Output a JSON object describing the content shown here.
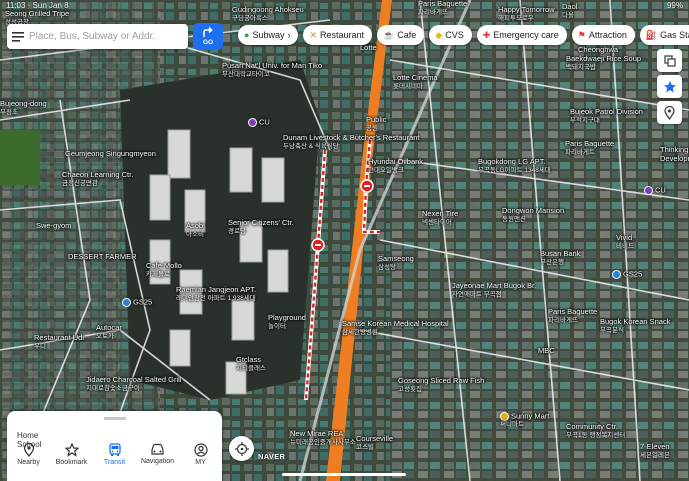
{
  "status_bar": {
    "time": "11:03",
    "date": "Sun Jan 8",
    "battery": "99%"
  },
  "search": {
    "placeholder": "Place, Bus, Subway or Addr.",
    "go_label": "GO"
  },
  "chips": [
    {
      "label": "Subway",
      "icon": "subway-icon"
    },
    {
      "label": "Restaurant",
      "icon": "utensils-icon"
    },
    {
      "label": "Cafe",
      "icon": "coffee-icon"
    },
    {
      "label": "CVS",
      "icon": "store-icon"
    },
    {
      "label": "Emergency care",
      "icon": "hospital-icon"
    },
    {
      "label": "Attraction",
      "icon": "flag-icon"
    },
    {
      "label": "Gas Stat",
      "icon": "fuel-icon"
    }
  ],
  "side_buttons": [
    "layers-icon",
    "favorite-star-icon",
    "location-pin-icon"
  ],
  "bottom_panel": {
    "tabs": [
      "Home",
      "School"
    ],
    "nav": [
      {
        "label": "Nearby",
        "icon": "pin-icon",
        "active": false
      },
      {
        "label": "Bookmark",
        "icon": "star-icon",
        "active": false
      },
      {
        "label": "Transit",
        "icon": "bus-icon",
        "active": true
      },
      {
        "label": "Navigation",
        "icon": "car-icon",
        "active": false
      },
      {
        "label": "MY",
        "icon": "user-icon",
        "active": false
      }
    ]
  },
  "map_labels": [
    {
      "id": "grilled-tripe",
      "en": "Seong Grilled Tripe",
      "ko": "성성곱창"
    },
    {
      "id": "gudingoong",
      "en": "Gudingoong Ahokseu",
      "ko": "구딩궁아흑스"
    },
    {
      "id": "paris-baguette-top",
      "en": "Paris Baguette",
      "ko": "파리바게뜨"
    },
    {
      "id": "happy-tomorrow",
      "en": "Happy Tomorrow",
      "ko": "해피투모로우"
    },
    {
      "id": "daol",
      "en": "Daol",
      "ko": "다올"
    },
    {
      "id": "lotte-top",
      "en": "Lotte",
      "ko": "롯데"
    },
    {
      "id": "pusan-univ",
      "en": "Pusan Nat'l Univ. for Man Tiko",
      "ko": "부산대학교타이코"
    },
    {
      "id": "cheonghwa",
      "en": "Cheonghwa",
      "ko": ""
    },
    {
      "id": "baekdwaeji",
      "en": "Baekdwaeji Rice Soup",
      "ko": "백돼지국밥"
    },
    {
      "id": "lotte-cinema",
      "en": "Lotte Cinema",
      "ko": "롯데시네마"
    },
    {
      "id": "bujeong",
      "en": "Bujeong-dong",
      "ko": "부정초"
    },
    {
      "id": "cu-left",
      "en": "CU",
      "ko": ""
    },
    {
      "id": "public",
      "en": "Public",
      "ko": "공원"
    },
    {
      "id": "bujeok-patrol",
      "en": "Bujeok Patrol Division",
      "ko": "부적지구대"
    },
    {
      "id": "dunam",
      "en": "Dunam Livestock & Butcher's Restaurant",
      "ko": "두남축산 & 식육식당"
    },
    {
      "id": "paris-baguette-right",
      "en": "Paris Baguette",
      "ko": "파리바게트"
    },
    {
      "id": "thinking",
      "en": "Thinking C",
      "ko": ""
    },
    {
      "id": "developm",
      "en": "Developm",
      "ko": ""
    },
    {
      "id": "geumjeong",
      "en": "Geumjeong Singungmyeon",
      "ko": ""
    },
    {
      "id": "chaeon",
      "en": "Chaeon Learning Ctr.",
      "ko": "금정신궁면관"
    },
    {
      "id": "hyundai-oilbank",
      "en": "Hyundai Oilbank",
      "ko": "현대오일뱅크"
    },
    {
      "id": "bugokdong-lg",
      "en": "Bugokdong LG APT.",
      "ko": "부곡동LG아파트 1348세대"
    },
    {
      "id": "cu-right",
      "en": "CU",
      "ko": ""
    },
    {
      "id": "swe-gyom",
      "en": "Swe-gyom",
      "ko": ""
    },
    {
      "id": "asobi",
      "en": "Asobi",
      "ko": "아소비"
    },
    {
      "id": "senior-citizens",
      "en": "Senior Citizens' Ctr.",
      "ko": "경로당"
    },
    {
      "id": "nexen",
      "en": "Nexen Tire",
      "ko": "넥센타이어"
    },
    {
      "id": "dongwon",
      "en": "Dongwon Mansion",
      "ko": "동원맨션"
    },
    {
      "id": "vivid",
      "en": "Vivid",
      "ko": "비비드"
    },
    {
      "id": "dessert-farmer",
      "en": "DESSERT FARMER",
      "ko": ""
    },
    {
      "id": "samseong",
      "en": "Samseong",
      "ko": "삼성탕"
    },
    {
      "id": "busan-bank",
      "en": "Busan Bank",
      "ko": "부산은행"
    },
    {
      "id": "cafe-mollo",
      "en": "Cafe Mollo",
      "ko": "카페몰로"
    },
    {
      "id": "raemian",
      "en": "Raemian Jangjeon APT.",
      "ko": "래미안장전 아파트 1,938세대"
    },
    {
      "id": "jayeonae",
      "en": "Jayeonae Mart Bugok Br.",
      "ko": "자연애마트 부곡점"
    },
    {
      "id": "gs25-left",
      "en": "GS25",
      "ko": ""
    },
    {
      "id": "gs25-right",
      "en": "GS25",
      "ko": ""
    },
    {
      "id": "autocar",
      "en": "Autocar",
      "ko": "오토카"
    },
    {
      "id": "playground",
      "en": "Playground",
      "ko": "놀이터"
    },
    {
      "id": "samse-korean",
      "en": "Samse Korean Medical Hospital",
      "ko": "삼세한방병원"
    },
    {
      "id": "paris-baguette-mid",
      "en": "Paris Baguette",
      "ko": "파리바게뜨"
    },
    {
      "id": "bugok-korean-snack",
      "en": "Bugok Korean Snack",
      "ko": "부곡분식"
    },
    {
      "id": "restaurant-udi",
      "en": "Restaurant Udi",
      "ko": "우디"
    },
    {
      "id": "gtclass",
      "en": "Gtclass",
      "ko": "지티클래스"
    },
    {
      "id": "mbc",
      "en": "MBC",
      "ko": ""
    },
    {
      "id": "jidaero",
      "en": "Jidaero Charcoal Salted Grill",
      "ko": "지대로참숯소금구이"
    },
    {
      "id": "goseong",
      "en": "Goseong Sliced Raw Fish",
      "ko": "고성횟집"
    },
    {
      "id": "sunny-mart",
      "en": "Sunny Mart",
      "ko": "써니마트"
    },
    {
      "id": "community-ctr",
      "en": "Community Ctr.",
      "ko": "부곡1동 행정복지센터"
    },
    {
      "id": "new-mirae",
      "en": "New Mirae REA",
      "ko": "뉴미래공인중개사사무소"
    },
    {
      "id": "courseville",
      "en": "Courseville",
      "ko": "코스빌"
    },
    {
      "id": "seven-eleven",
      "en": "7-Eleven",
      "ko": "세븐일레븐"
    }
  ],
  "branding": "NAVER"
}
